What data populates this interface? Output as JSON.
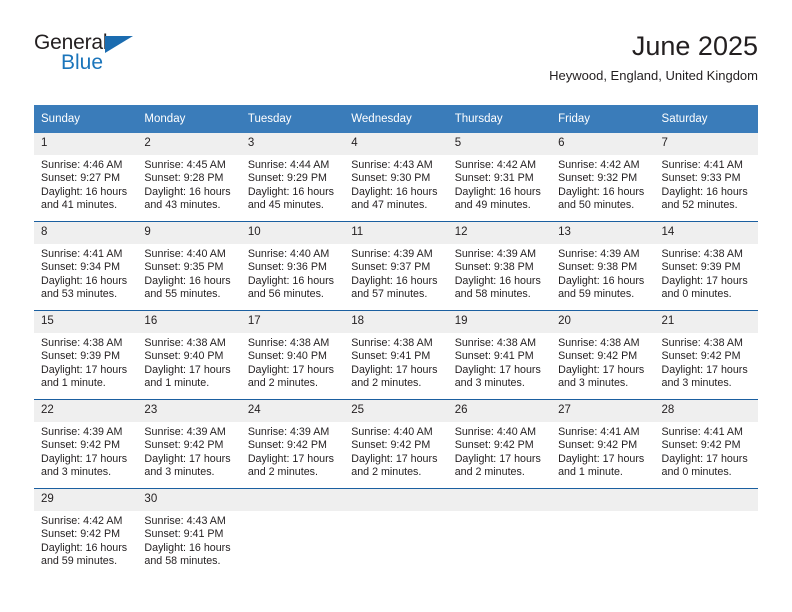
{
  "brand": {
    "name_top": "General",
    "name_bottom": "Blue",
    "accent_color": "#1b75bb",
    "triangle_color": "#1b6cb0"
  },
  "header": {
    "title": "June 2025",
    "subtitle": "Heywood, England, United Kingdom"
  },
  "theme": {
    "header_bg": "#3a7cba",
    "row_divider": "#1b5fa0",
    "daynum_bg": "#efefef",
    "text": "#231f20"
  },
  "weekdays": [
    "Sunday",
    "Monday",
    "Tuesday",
    "Wednesday",
    "Thursday",
    "Friday",
    "Saturday"
  ],
  "labels": {
    "sunrise": "Sunrise:",
    "sunset": "Sunset:",
    "daylight": "Daylight:"
  },
  "weeks": [
    [
      {
        "day": "1",
        "sunrise": "Sunrise: 4:46 AM",
        "sunset": "Sunset: 9:27 PM",
        "daylight": "Daylight: 16 hours and 41 minutes."
      },
      {
        "day": "2",
        "sunrise": "Sunrise: 4:45 AM",
        "sunset": "Sunset: 9:28 PM",
        "daylight": "Daylight: 16 hours and 43 minutes."
      },
      {
        "day": "3",
        "sunrise": "Sunrise: 4:44 AM",
        "sunset": "Sunset: 9:29 PM",
        "daylight": "Daylight: 16 hours and 45 minutes."
      },
      {
        "day": "4",
        "sunrise": "Sunrise: 4:43 AM",
        "sunset": "Sunset: 9:30 PM",
        "daylight": "Daylight: 16 hours and 47 minutes."
      },
      {
        "day": "5",
        "sunrise": "Sunrise: 4:42 AM",
        "sunset": "Sunset: 9:31 PM",
        "daylight": "Daylight: 16 hours and 49 minutes."
      },
      {
        "day": "6",
        "sunrise": "Sunrise: 4:42 AM",
        "sunset": "Sunset: 9:32 PM",
        "daylight": "Daylight: 16 hours and 50 minutes."
      },
      {
        "day": "7",
        "sunrise": "Sunrise: 4:41 AM",
        "sunset": "Sunset: 9:33 PM",
        "daylight": "Daylight: 16 hours and 52 minutes."
      }
    ],
    [
      {
        "day": "8",
        "sunrise": "Sunrise: 4:41 AM",
        "sunset": "Sunset: 9:34 PM",
        "daylight": "Daylight: 16 hours and 53 minutes."
      },
      {
        "day": "9",
        "sunrise": "Sunrise: 4:40 AM",
        "sunset": "Sunset: 9:35 PM",
        "daylight": "Daylight: 16 hours and 55 minutes."
      },
      {
        "day": "10",
        "sunrise": "Sunrise: 4:40 AM",
        "sunset": "Sunset: 9:36 PM",
        "daylight": "Daylight: 16 hours and 56 minutes."
      },
      {
        "day": "11",
        "sunrise": "Sunrise: 4:39 AM",
        "sunset": "Sunset: 9:37 PM",
        "daylight": "Daylight: 16 hours and 57 minutes."
      },
      {
        "day": "12",
        "sunrise": "Sunrise: 4:39 AM",
        "sunset": "Sunset: 9:38 PM",
        "daylight": "Daylight: 16 hours and 58 minutes."
      },
      {
        "day": "13",
        "sunrise": "Sunrise: 4:39 AM",
        "sunset": "Sunset: 9:38 PM",
        "daylight": "Daylight: 16 hours and 59 minutes."
      },
      {
        "day": "14",
        "sunrise": "Sunrise: 4:38 AM",
        "sunset": "Sunset: 9:39 PM",
        "daylight": "Daylight: 17 hours and 0 minutes."
      }
    ],
    [
      {
        "day": "15",
        "sunrise": "Sunrise: 4:38 AM",
        "sunset": "Sunset: 9:39 PM",
        "daylight": "Daylight: 17 hours and 1 minute."
      },
      {
        "day": "16",
        "sunrise": "Sunrise: 4:38 AM",
        "sunset": "Sunset: 9:40 PM",
        "daylight": "Daylight: 17 hours and 1 minute."
      },
      {
        "day": "17",
        "sunrise": "Sunrise: 4:38 AM",
        "sunset": "Sunset: 9:40 PM",
        "daylight": "Daylight: 17 hours and 2 minutes."
      },
      {
        "day": "18",
        "sunrise": "Sunrise: 4:38 AM",
        "sunset": "Sunset: 9:41 PM",
        "daylight": "Daylight: 17 hours and 2 minutes."
      },
      {
        "day": "19",
        "sunrise": "Sunrise: 4:38 AM",
        "sunset": "Sunset: 9:41 PM",
        "daylight": "Daylight: 17 hours and 3 minutes."
      },
      {
        "day": "20",
        "sunrise": "Sunrise: 4:38 AM",
        "sunset": "Sunset: 9:42 PM",
        "daylight": "Daylight: 17 hours and 3 minutes."
      },
      {
        "day": "21",
        "sunrise": "Sunrise: 4:38 AM",
        "sunset": "Sunset: 9:42 PM",
        "daylight": "Daylight: 17 hours and 3 minutes."
      }
    ],
    [
      {
        "day": "22",
        "sunrise": "Sunrise: 4:39 AM",
        "sunset": "Sunset: 9:42 PM",
        "daylight": "Daylight: 17 hours and 3 minutes."
      },
      {
        "day": "23",
        "sunrise": "Sunrise: 4:39 AM",
        "sunset": "Sunset: 9:42 PM",
        "daylight": "Daylight: 17 hours and 3 minutes."
      },
      {
        "day": "24",
        "sunrise": "Sunrise: 4:39 AM",
        "sunset": "Sunset: 9:42 PM",
        "daylight": "Daylight: 17 hours and 2 minutes."
      },
      {
        "day": "25",
        "sunrise": "Sunrise: 4:40 AM",
        "sunset": "Sunset: 9:42 PM",
        "daylight": "Daylight: 17 hours and 2 minutes."
      },
      {
        "day": "26",
        "sunrise": "Sunrise: 4:40 AM",
        "sunset": "Sunset: 9:42 PM",
        "daylight": "Daylight: 17 hours and 2 minutes."
      },
      {
        "day": "27",
        "sunrise": "Sunrise: 4:41 AM",
        "sunset": "Sunset: 9:42 PM",
        "daylight": "Daylight: 17 hours and 1 minute."
      },
      {
        "day": "28",
        "sunrise": "Sunrise: 4:41 AM",
        "sunset": "Sunset: 9:42 PM",
        "daylight": "Daylight: 17 hours and 0 minutes."
      }
    ],
    [
      {
        "day": "29",
        "sunrise": "Sunrise: 4:42 AM",
        "sunset": "Sunset: 9:42 PM",
        "daylight": "Daylight: 16 hours and 59 minutes."
      },
      {
        "day": "30",
        "sunrise": "Sunrise: 4:43 AM",
        "sunset": "Sunset: 9:41 PM",
        "daylight": "Daylight: 16 hours and 58 minutes."
      },
      {
        "day": "",
        "sunrise": "",
        "sunset": "",
        "daylight": ""
      },
      {
        "day": "",
        "sunrise": "",
        "sunset": "",
        "daylight": ""
      },
      {
        "day": "",
        "sunrise": "",
        "sunset": "",
        "daylight": ""
      },
      {
        "day": "",
        "sunrise": "",
        "sunset": "",
        "daylight": ""
      },
      {
        "day": "",
        "sunrise": "",
        "sunset": "",
        "daylight": ""
      }
    ]
  ]
}
